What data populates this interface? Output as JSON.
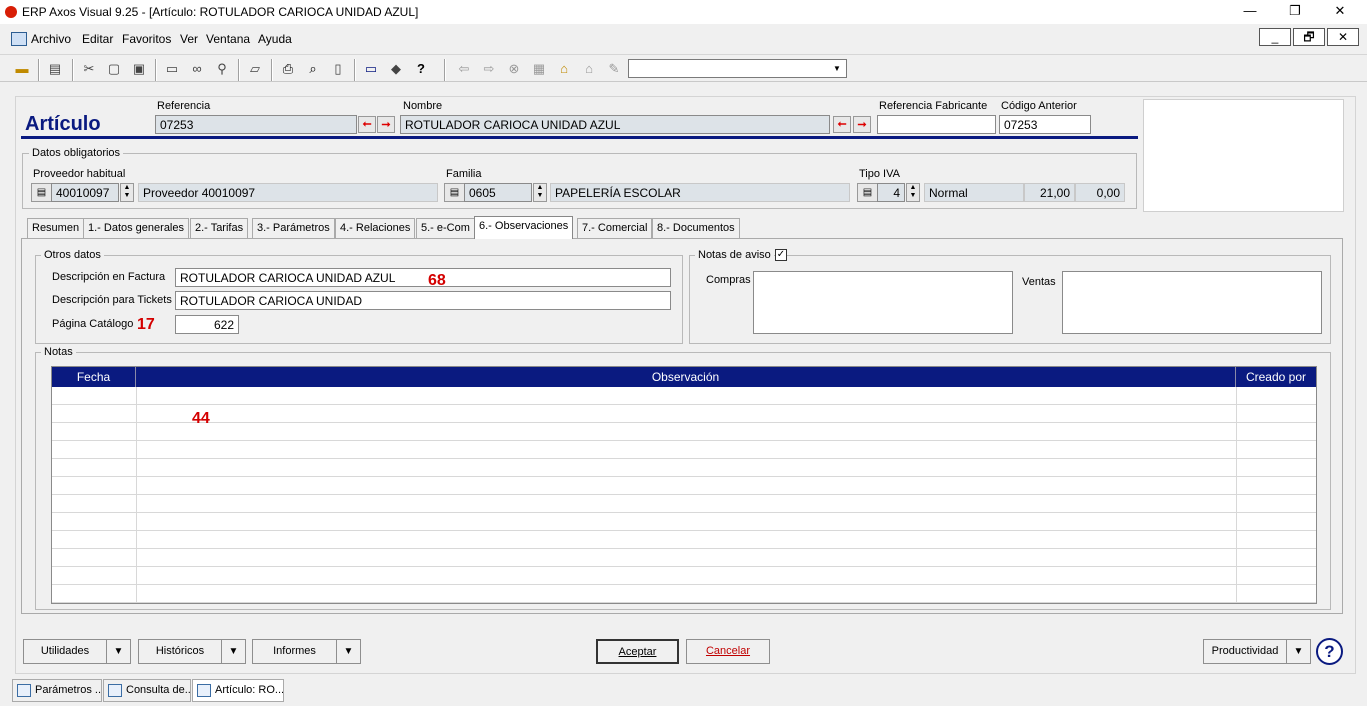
{
  "window": {
    "title": "ERP Axos Visual 9.25 - [Artículo: ROTULADOR CARIOCA UNIDAD AZUL]"
  },
  "menu": [
    "Archivo",
    "Editar",
    "Favoritos",
    "Ver",
    "Ventana",
    "Ayuda"
  ],
  "header": {
    "title": "Artículo",
    "referencia_label": "Referencia",
    "referencia_value": "07253",
    "nombre_label": "Nombre",
    "nombre_value": "ROTULADOR CARIOCA UNIDAD AZUL",
    "ref_fabricante_label": "Referencia Fabricante",
    "ref_fabricante_value": "",
    "codigo_anterior_label": "Código Anterior",
    "codigo_anterior_value": "07253"
  },
  "obligatorios": {
    "title": "Datos obligatorios",
    "proveedor_label": "Proveedor habitual",
    "proveedor_code": "40010097",
    "proveedor_name": "Proveedor 40010097",
    "familia_label": "Familia",
    "familia_code": "0605",
    "familia_name": "PAPELERÍA ESCOLAR",
    "iva_label": "Tipo IVA",
    "iva_code": "4",
    "iva_name": "Normal",
    "iva_pct": "21,00",
    "iva_re": "0,00"
  },
  "tabs": [
    "Resumen",
    "1.- Datos generales",
    "2.- Tarifas",
    "3.- Parámetros",
    "4.- Relaciones",
    "5.- e-Com",
    "6.- Observaciones",
    "7.- Comercial",
    "8.- Documentos"
  ],
  "otros": {
    "title": "Otros datos",
    "desc_factura_label": "Descripción en Factura",
    "desc_factura_value": "ROTULADOR CARIOCA UNIDAD AZUL",
    "desc_factura_count": "68",
    "desc_tickets_label": "Descripción para Tickets",
    "desc_tickets_value": "ROTULADOR CARIOCA UNIDAD",
    "pagina_label": "Página Catálogo",
    "pagina_count": "17",
    "pagina_value": "622"
  },
  "avisos": {
    "title": "Notas de aviso",
    "checked": "✓",
    "compras_label": "Compras",
    "ventas_label": "Ventas"
  },
  "notas": {
    "title": "Notas",
    "columns": [
      "Fecha",
      "Observación",
      "Creado por"
    ],
    "marker": "44"
  },
  "buttons": {
    "utilidades": "Utilidades",
    "historicos": "Históricos",
    "informes": "Informes",
    "aceptar": "Aceptar",
    "cancelar": "Cancelar",
    "productividad": "Productividad",
    "help": "?"
  },
  "taskbar": [
    "Parámetros ...",
    "Consulta de...",
    "Artículo: RO..."
  ]
}
